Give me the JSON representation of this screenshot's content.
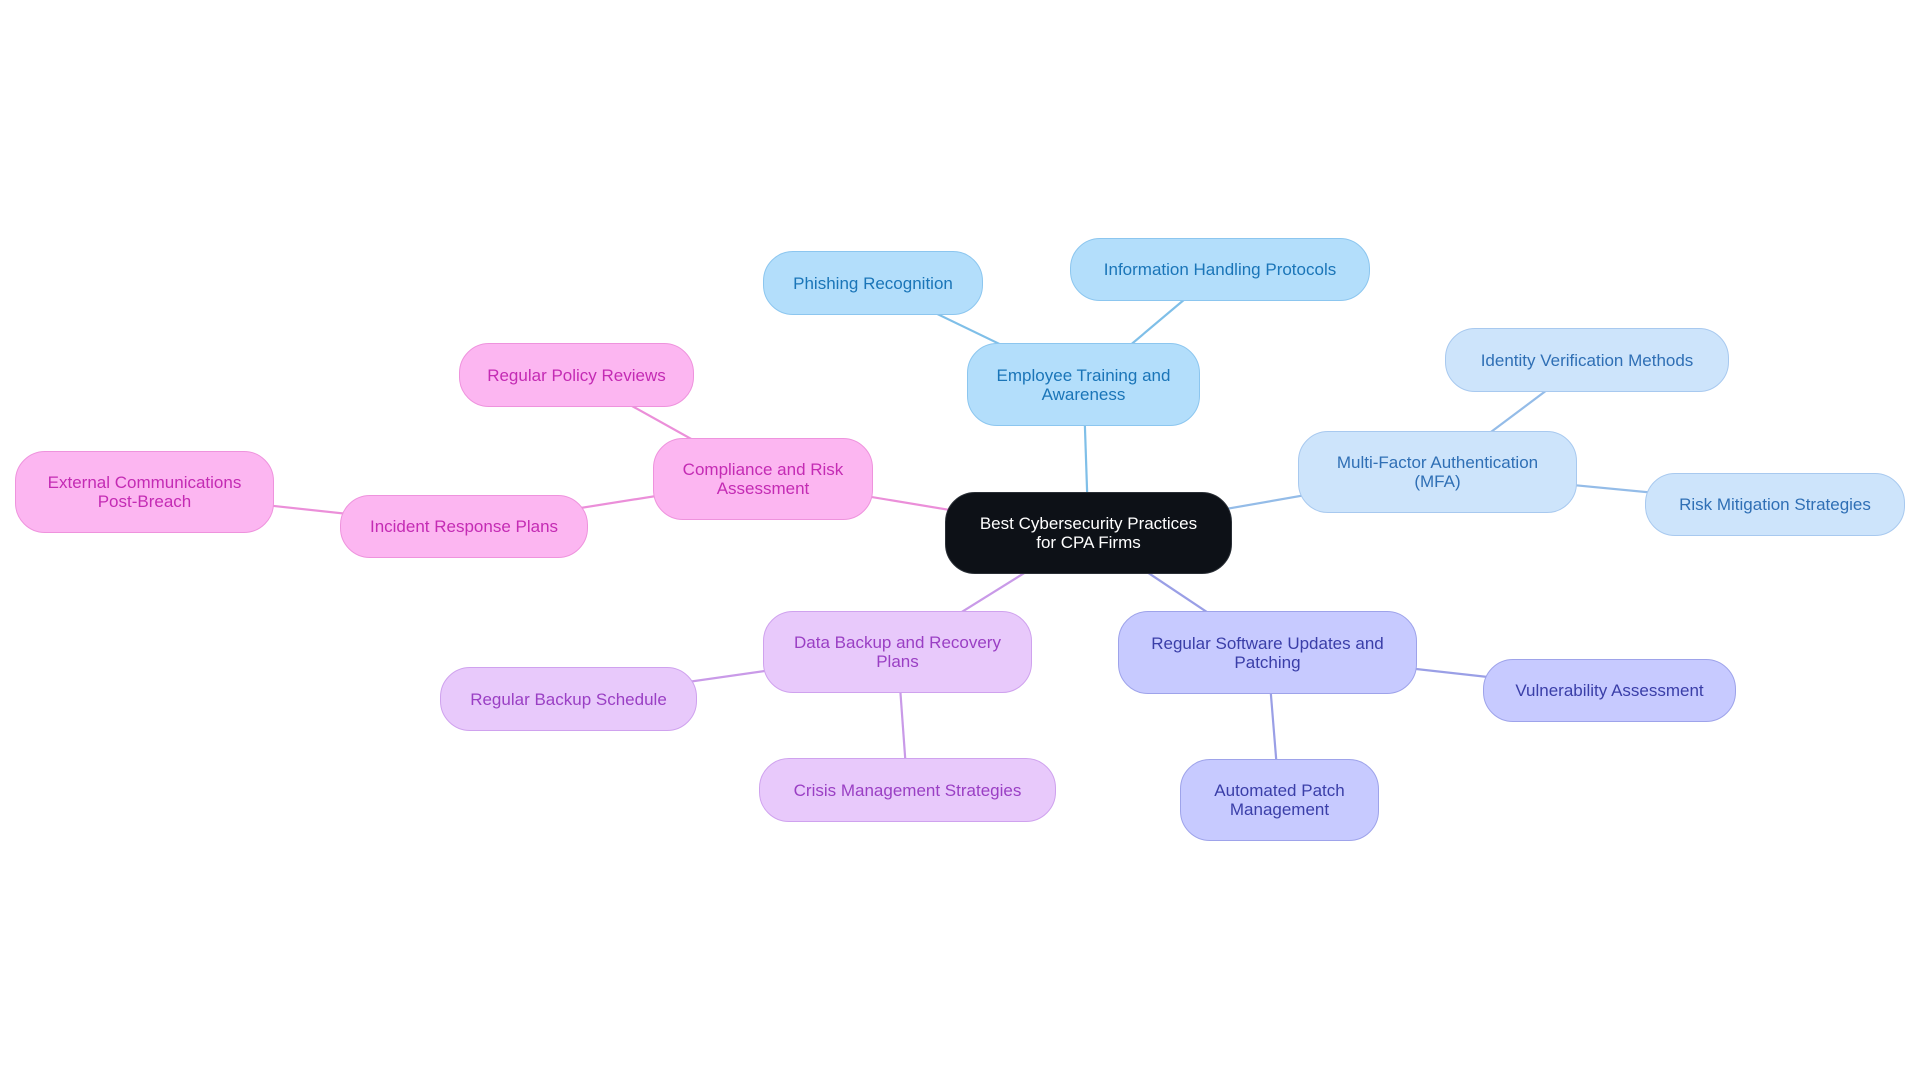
{
  "diagram": {
    "type": "mind-map",
    "root": "Best Cybersecurity Practices for CPA Firms",
    "branches": [
      {
        "id": "training",
        "label": "Employee Training and Awareness",
        "theme": "blue1",
        "children": [
          {
            "id": "phishing",
            "label": "Phishing Recognition"
          },
          {
            "id": "info",
            "label": "Information Handling Protocols"
          }
        ]
      },
      {
        "id": "mfa",
        "label": "Multi-Factor Authentication (MFA)",
        "theme": "blue2",
        "children": [
          {
            "id": "identity",
            "label": "Identity Verification Methods"
          },
          {
            "id": "riskmit",
            "label": "Risk Mitigation Strategies"
          }
        ]
      },
      {
        "id": "updates",
        "label": "Regular Software Updates and Patching",
        "theme": "indigo",
        "children": [
          {
            "id": "vuln",
            "label": "Vulnerability Assessment"
          },
          {
            "id": "autopatch",
            "label": "Automated Patch Management"
          }
        ]
      },
      {
        "id": "backup",
        "label": "Data Backup and Recovery Plans",
        "theme": "violet",
        "children": [
          {
            "id": "schedule",
            "label": "Regular Backup Schedule"
          },
          {
            "id": "crisis",
            "label": "Crisis Management Strategies"
          }
        ]
      },
      {
        "id": "compliance",
        "label": "Compliance and Risk Assessment",
        "theme": "pink",
        "children": [
          {
            "id": "policy",
            "label": "Regular Policy Reviews"
          },
          {
            "id": "incident",
            "label": "Incident Response Plans",
            "children": [
              {
                "id": "external",
                "label": "External Communications Post-Breach"
              }
            ]
          }
        ]
      }
    ]
  },
  "labels": {
    "root_line1": "Best Cybersecurity Practices",
    "root_line2": "for CPA Firms",
    "training_line1": "Employee Training and",
    "training_line2": "Awareness",
    "phishing": "Phishing Recognition",
    "info": "Information Handling Protocols",
    "mfa_line1": "Multi-Factor Authentication",
    "mfa_line2": "(MFA)",
    "identity": "Identity Verification Methods",
    "riskmit": "Risk Mitigation Strategies",
    "updates_line1": "Regular Software Updates and",
    "updates_line2": "Patching",
    "vuln": "Vulnerability Assessment",
    "autopatch_line1": "Automated Patch",
    "autopatch_line2": "Management",
    "backup_line1": "Data Backup and Recovery",
    "backup_line2": "Plans",
    "schedule": "Regular Backup Schedule",
    "crisis": "Crisis Management Strategies",
    "compliance_line1": "Compliance and Risk",
    "compliance_line2": "Assessment",
    "policy": "Regular Policy Reviews",
    "incident": "Incident Response Plans",
    "external_line1": "External Communications",
    "external_line2": "Post-Breach"
  },
  "colors": {
    "root_bg": "#0d1117",
    "blue1_edge": "#7fbfe8",
    "blue2_edge": "#94bce8",
    "indigo_edge": "#9a9fe6",
    "violet_edge": "#c99ae8",
    "pink_edge": "#eb8fd9"
  }
}
